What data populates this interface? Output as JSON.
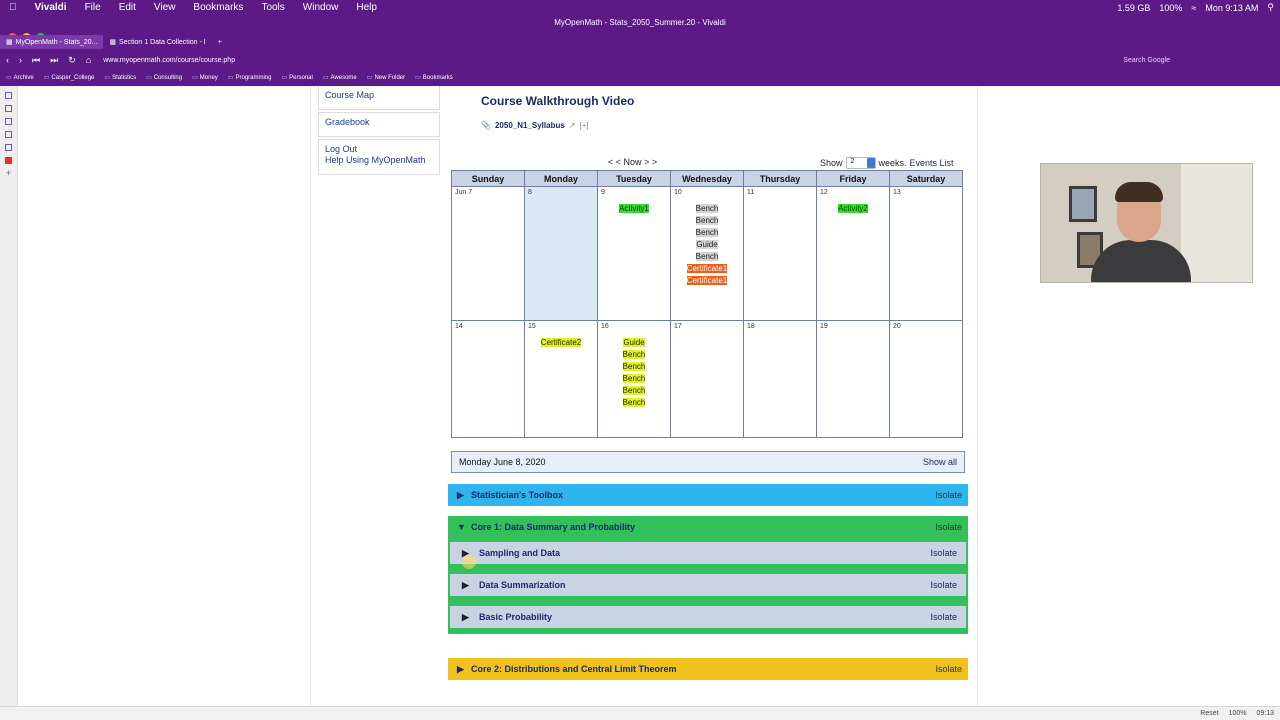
{
  "menubar": {
    "app": "Vivaldi",
    "items": [
      "File",
      "Edit",
      "View",
      "Bookmarks",
      "Tools",
      "Window",
      "Help"
    ],
    "window_title": "MyOpenMath - Stats_2050_Summer.20 - Vivaldi",
    "battery": "100%",
    "memory": "1.59 GB",
    "clock": "Mon 9:13 AM"
  },
  "tabs": [
    {
      "label": "MyOpenMath - Stats_20..."
    },
    {
      "label": "Section 1 Data Collection - I"
    }
  ],
  "address": {
    "url": "www.myopenmath.com/course/course.php",
    "search_placeholder": "Search Google"
  },
  "bookmarks": [
    "Archive",
    "Casper_College",
    "Statistics",
    "Consulting",
    "Money",
    "Programming",
    "Personal",
    "Awesome",
    "New Folder",
    "Bookmarks"
  ],
  "leftnav": {
    "course_map": "Course Map",
    "gradebook": "Gradebook",
    "logout": "Log Out",
    "help": "Help Using MyOpenMath"
  },
  "page": {
    "title": "Course Walkthrough Video",
    "syllabus_link": "2050_N1_Syllabus",
    "syllabus_plus": "[+]"
  },
  "calendar": {
    "nav_prev": "< <",
    "nav_now": "Now",
    "nav_next": "> >",
    "show_label": "Show",
    "weeks_value": "2",
    "weeks_label": "weeks.",
    "events_list": "Events List",
    "days": [
      "Sunday",
      "Monday",
      "Tuesday",
      "Wednesday",
      "Thursday",
      "Friday",
      "Saturday"
    ],
    "week1": [
      {
        "num": "Jun 7",
        "events": []
      },
      {
        "num": "8",
        "events": [],
        "today": true
      },
      {
        "num": "9",
        "events": [
          {
            "label": "Activity1",
            "color": "green"
          }
        ]
      },
      {
        "num": "10",
        "events": [
          {
            "label": "Bench",
            "color": "gray"
          },
          {
            "label": "Bench",
            "color": "gray"
          },
          {
            "label": "Bench",
            "color": "gray"
          },
          {
            "label": "Guide",
            "color": "gray"
          },
          {
            "label": "Bench",
            "color": "gray"
          },
          {
            "label": "Certificate1",
            "color": "orange"
          },
          {
            "label": "Certificate1",
            "color": "orange"
          }
        ]
      },
      {
        "num": "11",
        "events": []
      },
      {
        "num": "12",
        "events": [
          {
            "label": "Activity2",
            "color": "green"
          }
        ]
      },
      {
        "num": "13",
        "events": []
      }
    ],
    "week2": [
      {
        "num": "14",
        "events": []
      },
      {
        "num": "15",
        "events": [
          {
            "label": "Certificate2",
            "color": "yellow"
          }
        ]
      },
      {
        "num": "16",
        "events": [
          {
            "label": "Guide",
            "color": "yellow"
          },
          {
            "label": "Bench",
            "color": "yellow"
          },
          {
            "label": "Bench",
            "color": "yellow"
          },
          {
            "label": "Bench",
            "color": "yellow"
          },
          {
            "label": "Bench",
            "color": "yellow"
          },
          {
            "label": "Bench",
            "color": "yellow"
          }
        ]
      },
      {
        "num": "17",
        "events": []
      },
      {
        "num": "18",
        "events": []
      },
      {
        "num": "19",
        "events": []
      },
      {
        "num": "20",
        "events": []
      }
    ],
    "selected_day": "Monday June 8, 2020",
    "show_all": "Show all"
  },
  "blocks": {
    "toolbox": {
      "title": "Statistician's Toolbox",
      "isolate": "Isolate"
    },
    "core1": {
      "title": "Core 1: Data Summary and Probability",
      "isolate": "Isolate",
      "subs": [
        {
          "title": "Sampling and Data",
          "isolate": "Isolate"
        },
        {
          "title": "Data Summarization",
          "isolate": "Isolate"
        },
        {
          "title": "Basic Probability",
          "isolate": "Isolate"
        }
      ]
    },
    "core2": {
      "title": "Core 2: Distributions and Central Limit Theorem",
      "isolate": "Isolate"
    }
  },
  "statusbar": {
    "zoom": "100%",
    "reset": "Reset",
    "time": "09:13"
  }
}
